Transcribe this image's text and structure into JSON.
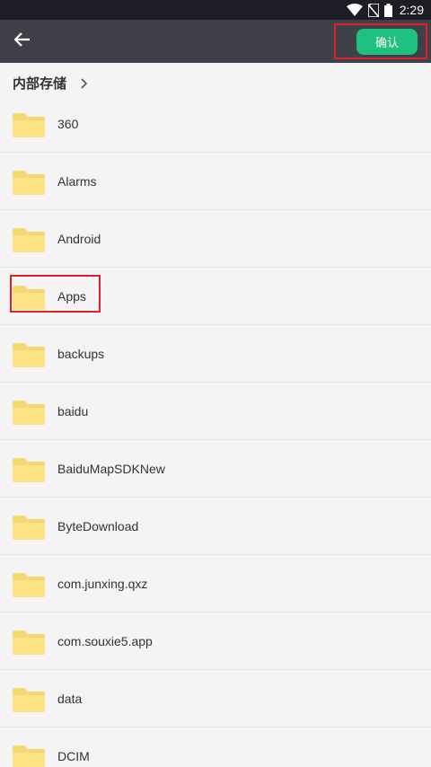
{
  "status_bar": {
    "time": "2:29",
    "icons": [
      "wifi-icon",
      "no-sim-icon",
      "battery-icon"
    ]
  },
  "app_bar": {
    "back_icon": "arrow-left-icon",
    "confirm_label": "确认",
    "confirm_color": "#1fc180",
    "highlight_color": "#e0202a"
  },
  "breadcrumb": {
    "current": "内部存储",
    "separator_icon": "chevron-right-icon"
  },
  "folders": [
    {
      "name": "360"
    },
    {
      "name": "Alarms"
    },
    {
      "name": "Android"
    },
    {
      "name": "Apps",
      "highlighted": true
    },
    {
      "name": "backups"
    },
    {
      "name": "baidu"
    },
    {
      "name": "BaiduMapSDKNew"
    },
    {
      "name": "ByteDownload"
    },
    {
      "name": "com.junxing.qxz"
    },
    {
      "name": "com.souxie5.app"
    },
    {
      "name": "data"
    },
    {
      "name": "DCIM"
    }
  ],
  "folder_icon": "folder-icon",
  "folder_color": "#fde383"
}
